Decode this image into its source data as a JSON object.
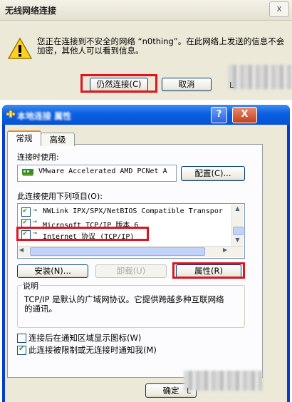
{
  "warning_dialog": {
    "title": "无线网络连接",
    "close_label": "x",
    "message_line1": "您正在连接到不安全的网络 “n0thing”。在此网络上发送的信息不会",
    "message_line2": "加密，其他人可以看到信息。",
    "connect_anyway_label": "仍然连接(C)",
    "cancel_label": "取消",
    "obscured_fragment": "L"
  },
  "properties_window": {
    "title": "本地连接 属性",
    "help_label": "?",
    "close_label": "X",
    "tabs": [
      "常规",
      "高级"
    ],
    "connect_using_label": "连接时使用:",
    "adapter_name": "VMware Accelerated AMD PCNet A",
    "configure_label": "配置(C)...",
    "components_label": "此连接使用下列项目(O):",
    "components": [
      {
        "label": "NWLink IPX/SPX/NetBIOS Compatible Transpor",
        "checked": true
      },
      {
        "label": "Microsoft TCP/IP 版本 6",
        "checked": true
      },
      {
        "label": "Internet 协议 (TCP/IP)",
        "checked": true
      }
    ],
    "install_label": "安装(N)...",
    "uninstall_label": "卸载(U)",
    "properties_label": "属性(R)",
    "description_legend": "说明",
    "description_line1": "TCP/IP 是默认的广域网协议。它提供跨越多种互联网络",
    "description_line2": "的通讯。",
    "option_show_icon": {
      "label": "连接后在通知区域显示图标(W)",
      "checked": false
    },
    "option_notify_limited": {
      "label": "此连接被限制或无连接时通知我(M)",
      "checked": true
    },
    "ok_label": "确定",
    "obscured_fragment": "L"
  },
  "colors": {
    "highlight_box": "#e0141e",
    "titlebar_blue": "#0a5fe0",
    "dialog_bg": "#ece9d8"
  },
  "icons": [
    "warning-icon",
    "network-adapter-icon",
    "network-component-icon",
    "connection-icon"
  ]
}
